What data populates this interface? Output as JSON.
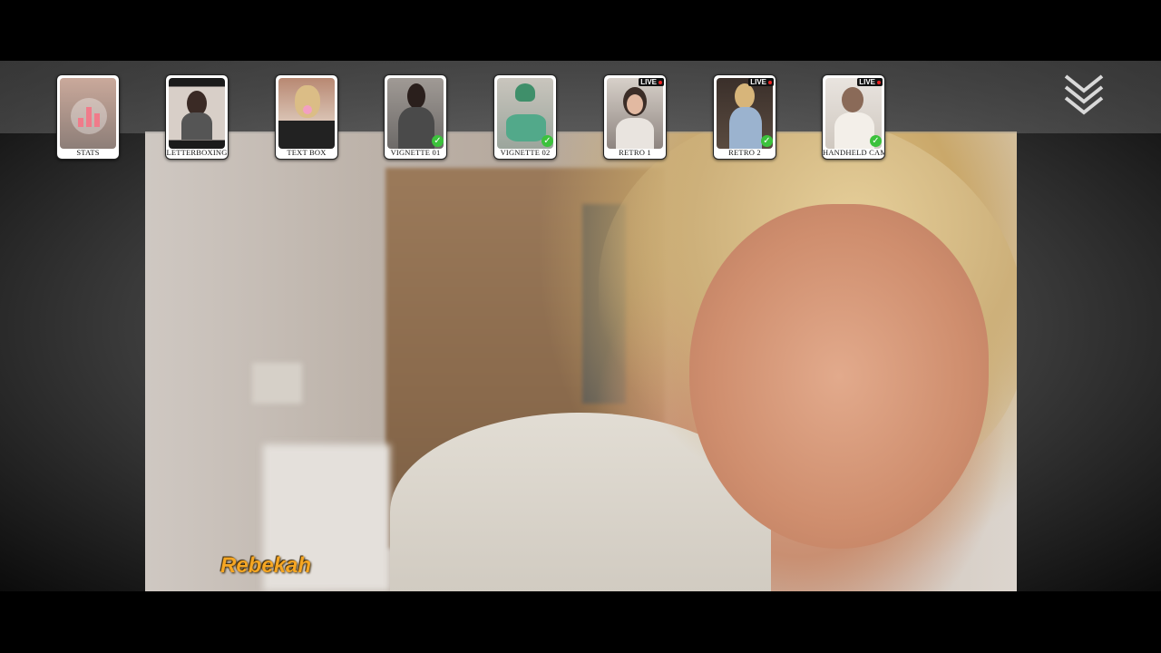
{
  "speaker": {
    "name": "Rebekah"
  },
  "menu": {
    "items": [
      {
        "label": "STATS",
        "icon": "stats-icon",
        "completed": false,
        "live": false
      },
      {
        "label": "LETTERBOXING",
        "icon": "thumbnail-woman-dark-hair",
        "completed": false,
        "live": false
      },
      {
        "label": "TEXT BOX",
        "icon": "thumbnail-woman-blonde-bubblegum",
        "completed": false,
        "live": false
      },
      {
        "label": "VIGNETTE 01",
        "icon": "thumbnail-woman-dark-hair-cardigan",
        "completed": true,
        "live": false
      },
      {
        "label": "VIGNETTE 02",
        "icon": "thumbnail-scooter-rider-helmet",
        "completed": true,
        "live": false
      },
      {
        "label": "RETRO 1",
        "icon": "thumbnail-woman-retro",
        "completed": false,
        "live": true,
        "live_label": "LIVE"
      },
      {
        "label": "RETRO 2",
        "icon": "thumbnail-blonde-woman-guitar",
        "completed": true,
        "live": true,
        "live_label": "LIVE"
      },
      {
        "label": "HANDHELD CAMERA",
        "icon": "thumbnail-man-handheld",
        "completed": true,
        "live": true,
        "live_label": "LIVE"
      }
    ],
    "collapse_icon": "double-chevron-down-icon"
  },
  "colors": {
    "speaker_name": "#f5a623",
    "check": "#3cc23c",
    "stats_bars": "#f07b8a"
  }
}
